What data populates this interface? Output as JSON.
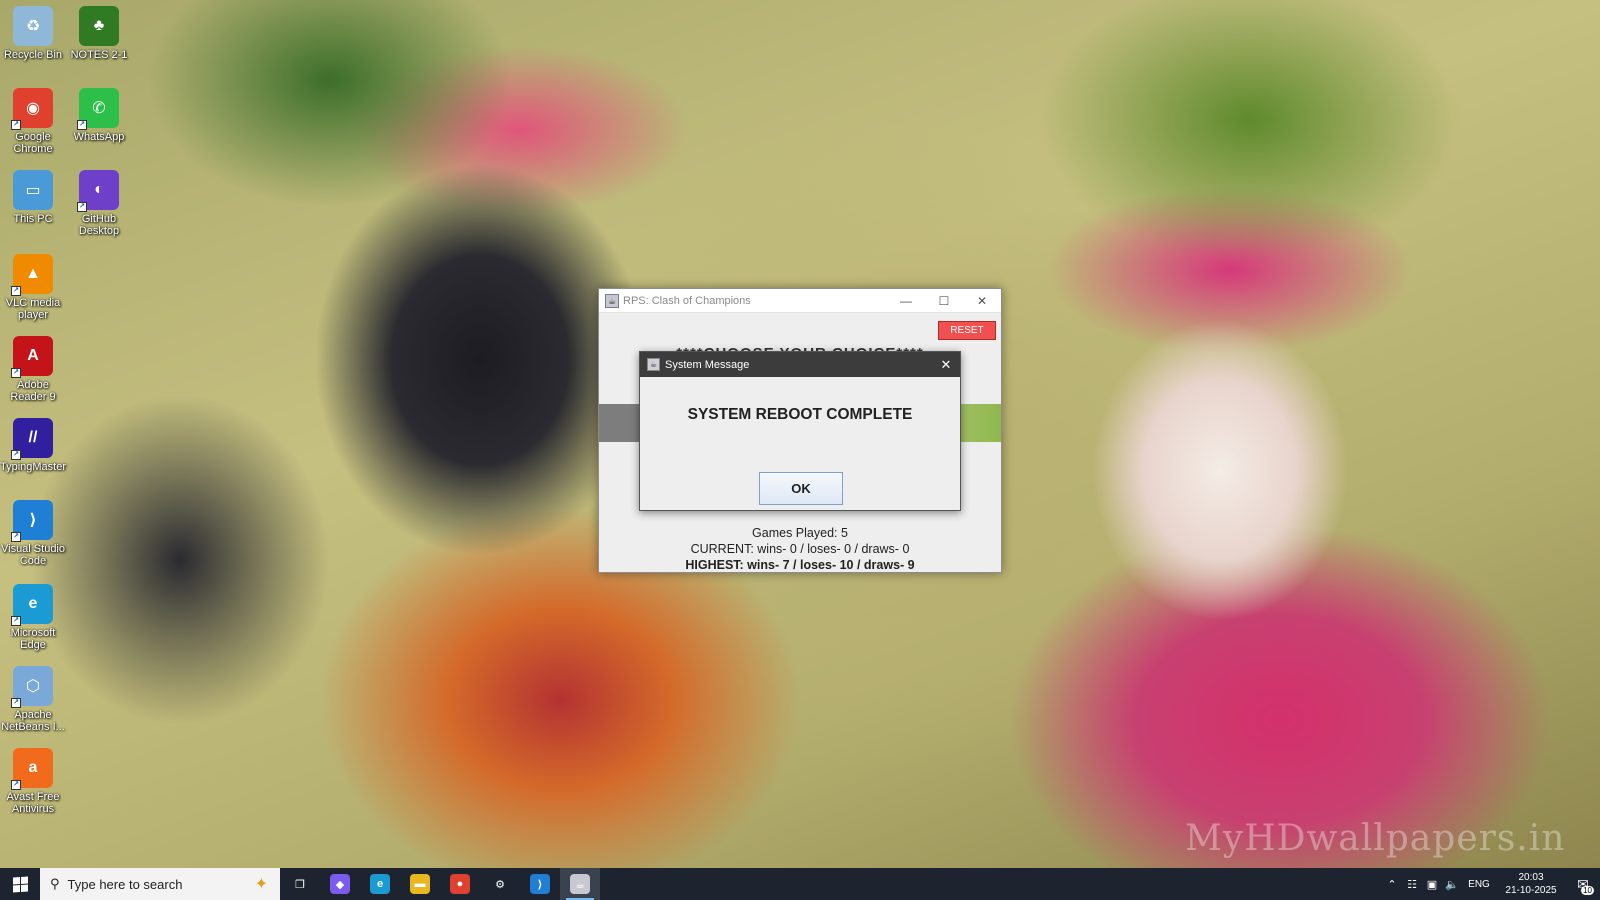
{
  "desktop": {
    "icons": [
      {
        "label": "Recycle Bin",
        "icon": "recycle-bin-icon",
        "color": "#8fb7d8"
      },
      {
        "label": "NOTES 2-1",
        "icon": "tree-icon",
        "color": "#2f7a22"
      },
      {
        "label": "Google Chrome",
        "icon": "chrome-icon",
        "color": "#e0412f"
      },
      {
        "label": "WhatsApp",
        "icon": "whatsapp-icon",
        "color": "#2cc04a"
      },
      {
        "label": "This PC",
        "icon": "computer-icon",
        "color": "#4a9ad8"
      },
      {
        "label": "GitHub Desktop",
        "icon": "github-icon",
        "color": "#6e40c9"
      },
      {
        "label": "VLC media player",
        "icon": "vlc-cone-icon",
        "color": "#f08a00"
      },
      {
        "label": "Adobe Reader 9",
        "icon": "adobe-reader-icon",
        "color": "#c4141a"
      },
      {
        "label": "TypingMaster",
        "icon": "typingmaster-icon",
        "color": "#3020a0"
      },
      {
        "label": "Visual Studio Code",
        "icon": "vscode-icon",
        "color": "#1f7fd4"
      },
      {
        "label": "Microsoft Edge",
        "icon": "edge-icon",
        "color": "#1a9bd4"
      },
      {
        "label": "Apache NetBeans I...",
        "icon": "netbeans-icon",
        "color": "#7aa8d8"
      },
      {
        "label": "Avast Free Antivirus",
        "icon": "avast-icon",
        "color": "#f26a1b"
      }
    ],
    "watermark": "MyHDwallpapers.in"
  },
  "app_window": {
    "title": "RPS: Clash of Champions",
    "reset_label": "RESET",
    "choose_text": "****CHOOSE YOUR CHOICE****",
    "games_played": "Games Played: 5",
    "current": "CURRENT: wins- 0 / loses- 0 / draws- 0",
    "highest": "HIGHEST: wins- 7 / loses- 10 / draws- 9"
  },
  "dialog": {
    "title": "System Message",
    "message": "SYSTEM REBOOT COMPLETE",
    "ok_label": "OK"
  },
  "taskbar": {
    "search_placeholder": "Type here to search",
    "apps": [
      {
        "icon": "task-view-icon",
        "glyph": "❐",
        "color": "#1d2430"
      },
      {
        "icon": "copilot-icon",
        "glyph": "◆",
        "color": "#7a5cf0"
      },
      {
        "icon": "edge-icon",
        "glyph": "e",
        "color": "#1a9bd4"
      },
      {
        "icon": "file-explorer-icon",
        "glyph": "▬",
        "color": "#e8b820"
      },
      {
        "icon": "chrome-icon",
        "glyph": "●",
        "color": "#e0412f"
      },
      {
        "icon": "settings-gear-icon",
        "glyph": "⚙",
        "color": "#1d2430"
      },
      {
        "icon": "vscode-icon",
        "glyph": "⟩",
        "color": "#1f7fd4"
      },
      {
        "icon": "java-app-icon",
        "glyph": "☕",
        "color": "#c8c8d0"
      }
    ],
    "language": "ENG",
    "time": "20:03",
    "date": "21-10-2025",
    "notification_count": "10"
  }
}
